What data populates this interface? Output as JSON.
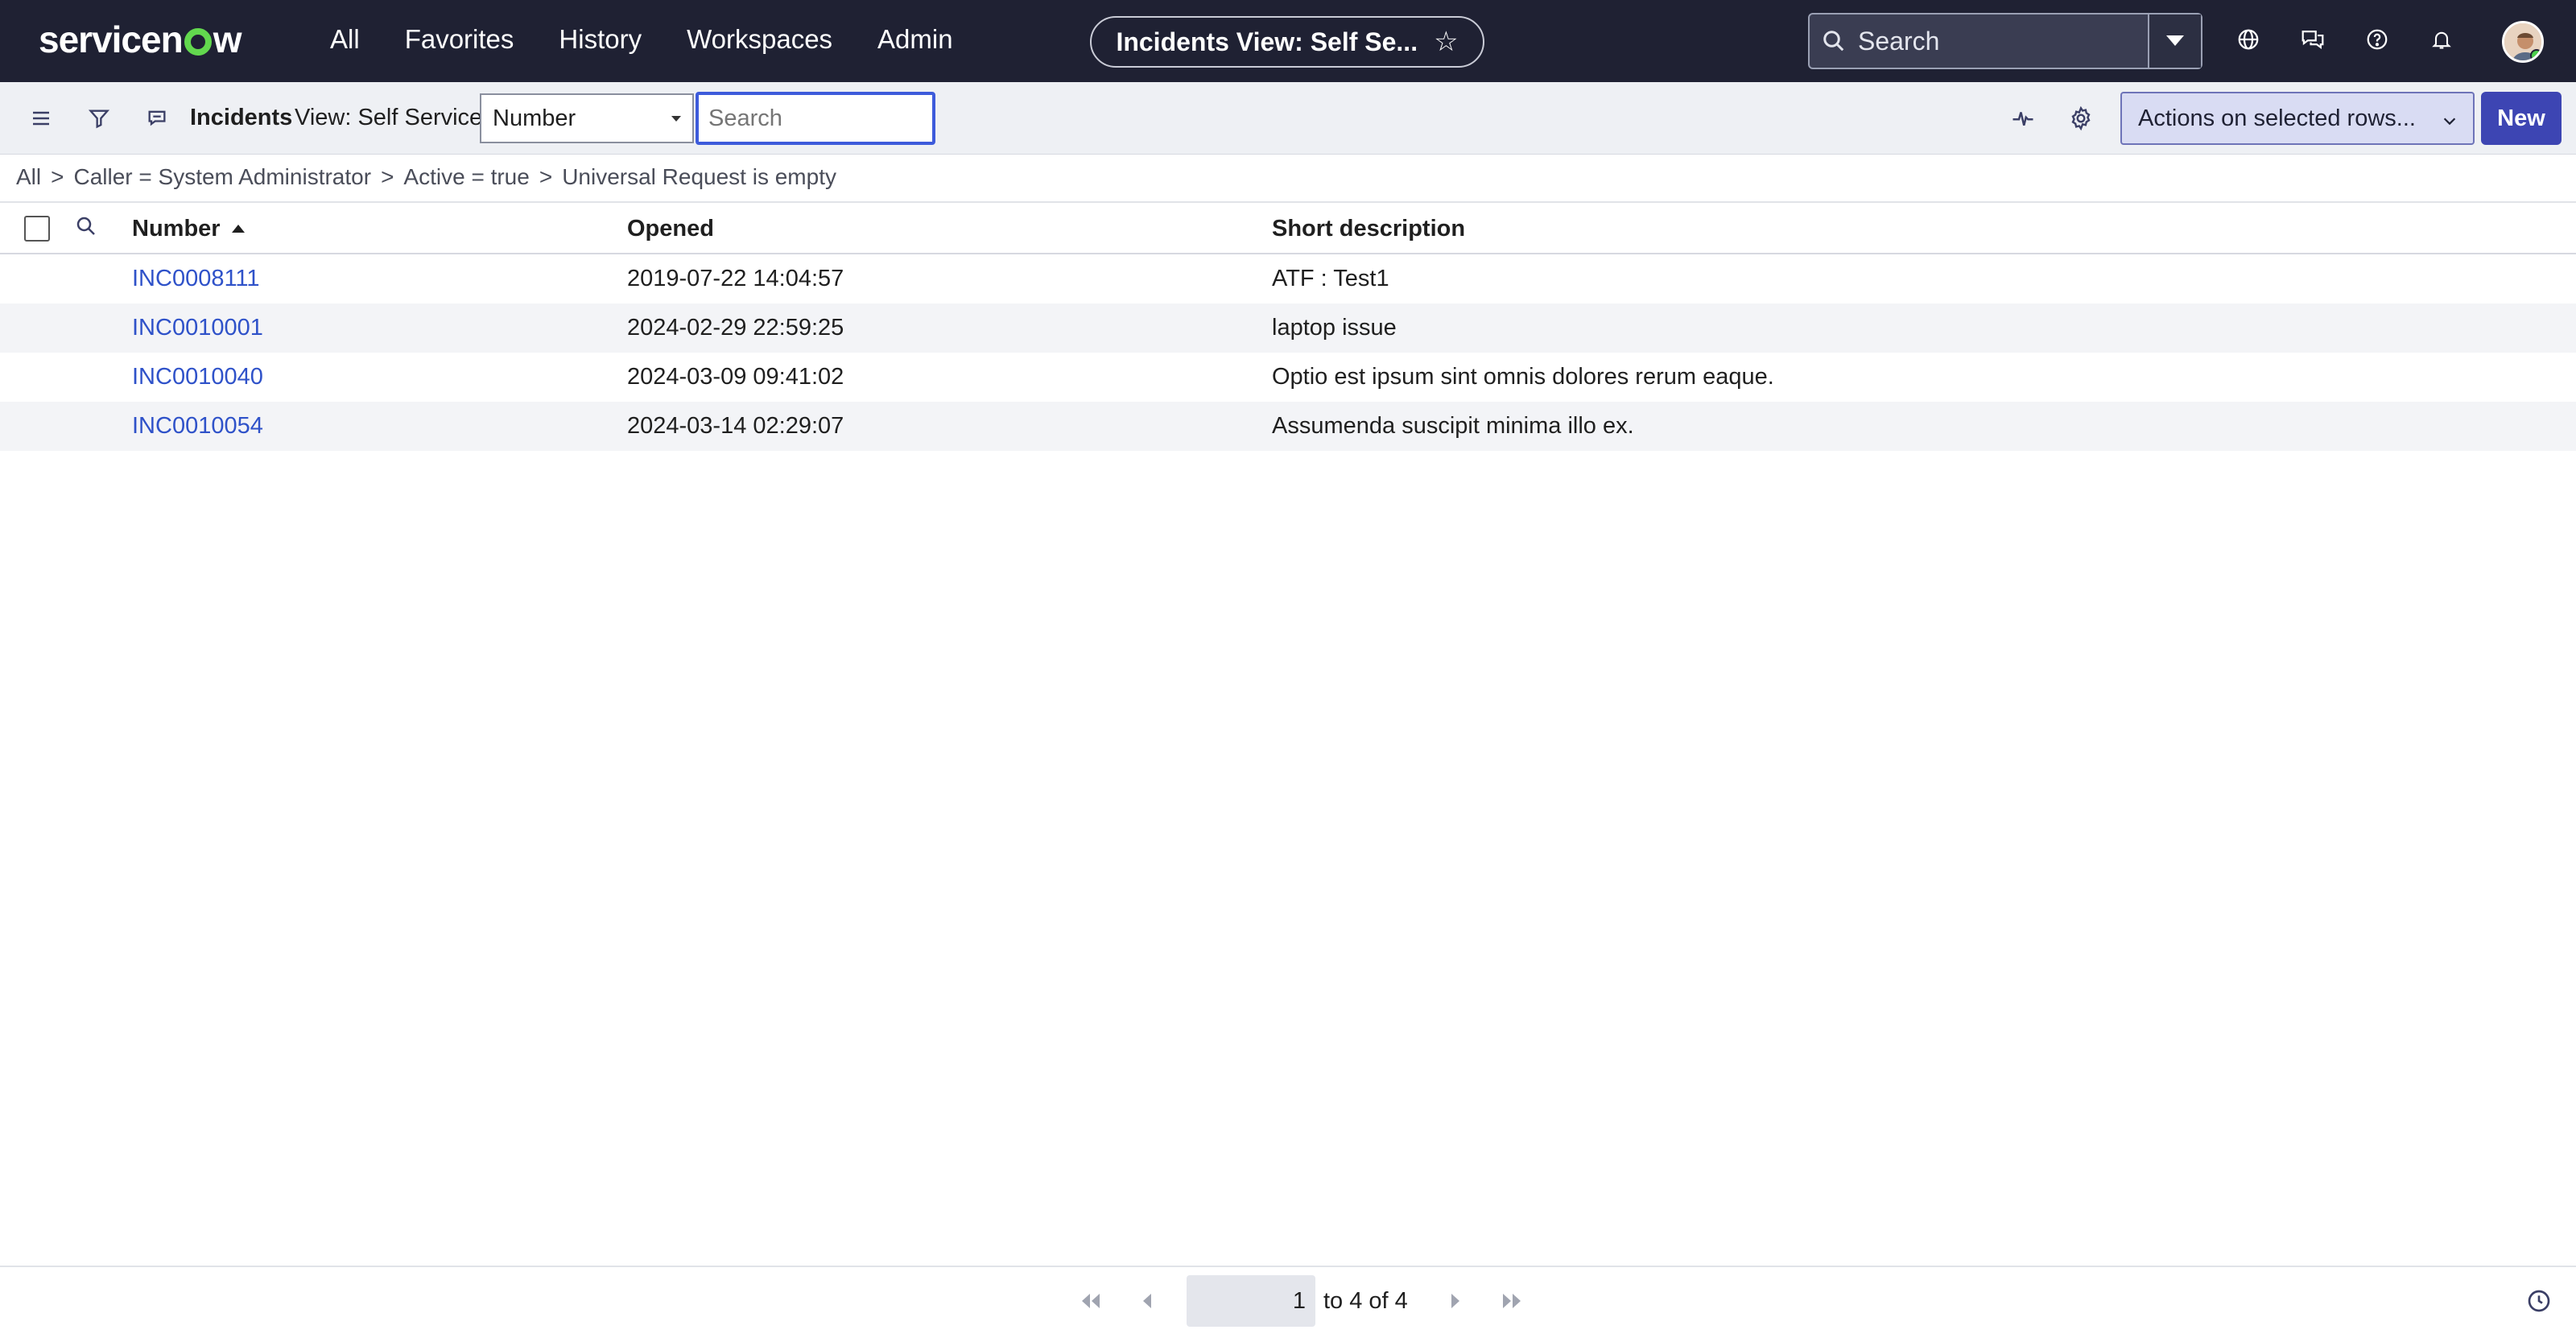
{
  "topnav": {
    "logo": "servicenow",
    "menu": [
      "All",
      "Favorites",
      "History",
      "Workspaces",
      "Admin"
    ],
    "context_title": "Incidents View: Self Se...",
    "search_placeholder": "Search"
  },
  "toolbar": {
    "title": "Incidents",
    "view": "View: Self Service",
    "field_select": "Number",
    "search_placeholder": "Search",
    "actions_select": "Actions on selected rows...",
    "new_label": "New"
  },
  "breadcrumb": [
    "All",
    "Caller = System Administrator",
    "Active = true",
    "Universal Request is empty"
  ],
  "table": {
    "columns": [
      "Number",
      "Opened",
      "Short description"
    ],
    "rows": [
      {
        "number": "INC0008111",
        "opened": "2019-07-22 14:04:57",
        "short_description": "ATF : Test1"
      },
      {
        "number": "INC0010001",
        "opened": "2024-02-29 22:59:25",
        "short_description": "laptop issue"
      },
      {
        "number": "INC0010040",
        "opened": "2024-03-09 09:41:02",
        "short_description": "Optio est ipsum sint omnis dolores rerum eaque."
      },
      {
        "number": "INC0010054",
        "opened": "2024-03-14 02:29:07",
        "short_description": "Assumenda suscipit minima illo ex."
      }
    ]
  },
  "pager": {
    "page_input": "1",
    "range_text": "to 4 of 4"
  },
  "colors": {
    "nav_bg": "#1f2133",
    "link": "#2f52c9",
    "primary_button": "#3d45b3",
    "logo_accent": "#62d84e"
  }
}
